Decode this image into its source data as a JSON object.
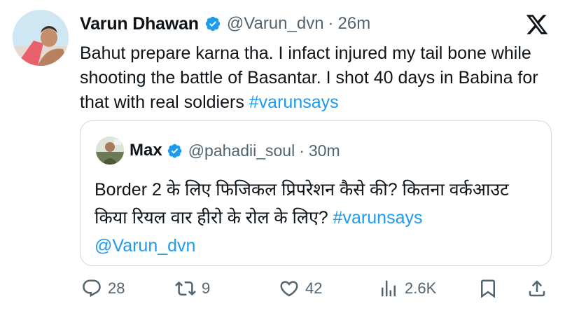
{
  "post": {
    "author_name": "Varun Dhawan",
    "handle": "@Varun_dvn",
    "separator": "·",
    "time": "26m",
    "text_main": "Bahut prepare karna tha. I infact injured my tail bone while shooting the battle of Basantar. I shot 40 days in Babina for that with real soldiers ",
    "text_hashtag": "#varunsays"
  },
  "quoted": {
    "author_name": "Max",
    "handle": "@pahadii_soul",
    "separator": "·",
    "time": "30m",
    "text_main": "Border 2 के लिए फिजिकल प्रिपरेशन कैसे की? कितना वर्कआउट किया रियल वार हीरो के रोल के लिए? ",
    "text_hashtag": "#varunsays",
    "text_mention": "@Varun_dvn"
  },
  "actions": {
    "replies": "28",
    "reposts": "9",
    "likes": "42",
    "views": "2.6K"
  },
  "colors": {
    "accent": "#1d9bf0",
    "text": "#0f1419",
    "muted": "#536471",
    "border": "#cfd9de"
  },
  "icons": [
    "verified-badge-icon",
    "x-logo-icon",
    "reply-icon",
    "repost-icon",
    "like-icon",
    "views-icon",
    "bookmark-icon",
    "share-icon"
  ]
}
